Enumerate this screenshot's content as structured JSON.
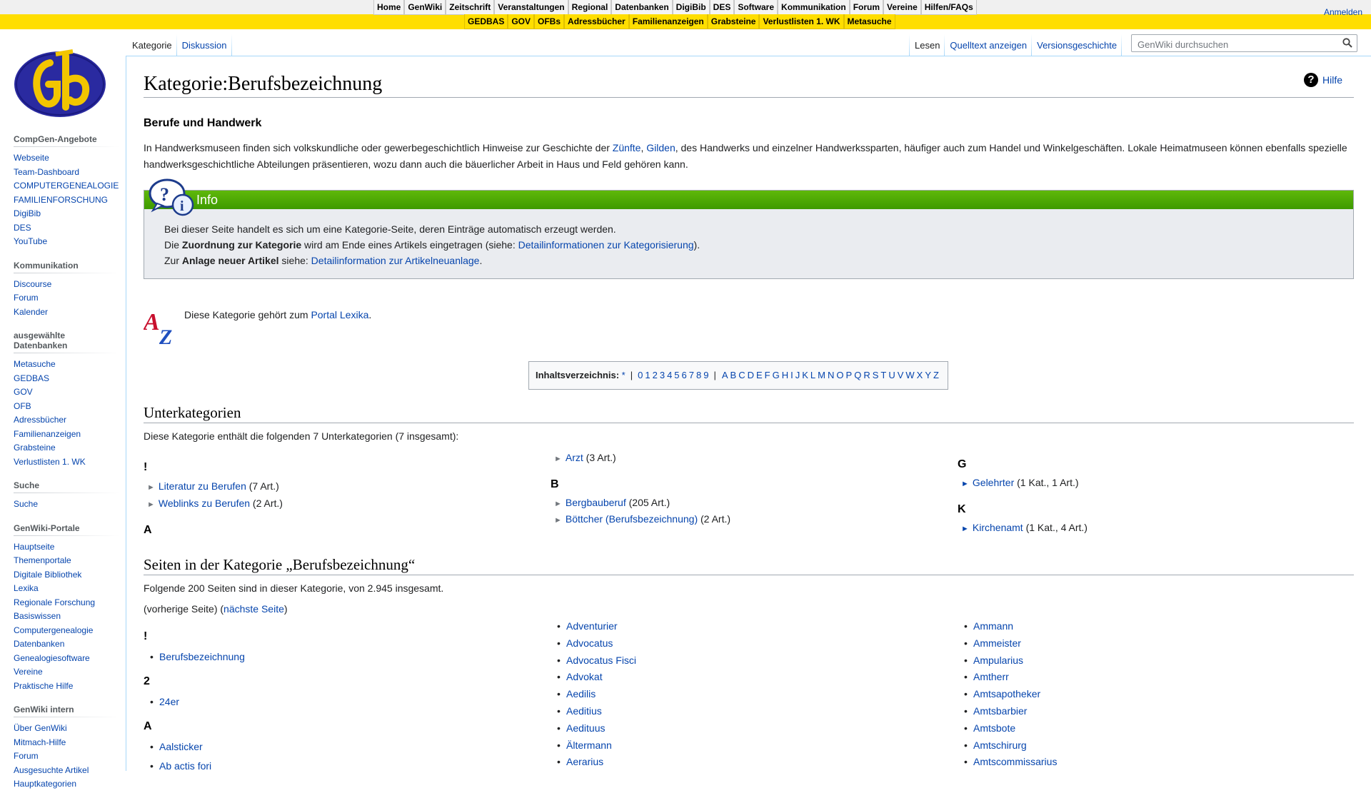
{
  "topnav": {
    "row1": [
      "Home",
      "GenWiki",
      "Zeitschrift",
      "Veranstaltungen",
      "Regional",
      "Datenbanken",
      "DigiBib",
      "DES",
      "Software",
      "Kommunikation",
      "Forum",
      "Vereine",
      "Hilfen/FAQs"
    ],
    "row2": [
      "GEDBAS",
      "GOV",
      "OFBs",
      "Adressbücher",
      "Familienanzeigen",
      "Grabsteine",
      "Verlustlisten 1. WK",
      "Metasuche"
    ],
    "login": "Anmelden"
  },
  "tabs": {
    "left": [
      "Kategorie",
      "Diskussion"
    ],
    "right": [
      "Lesen",
      "Quelltext anzeigen",
      "Versionsgeschichte"
    ]
  },
  "search": {
    "placeholder": "GenWiki durchsuchen"
  },
  "sidebar": [
    {
      "heading": "CompGen-Angebote",
      "items": [
        "Webseite",
        "Team-Dashboard",
        "COMPUTERGENEALOGIE",
        "FAMILIENFORSCHUNG",
        "DigiBib",
        "DES",
        "YouTube"
      ]
    },
    {
      "heading": "Kommunikation",
      "items": [
        "Discourse",
        "Forum",
        "Kalender"
      ]
    },
    {
      "heading": "ausgewählte Datenbanken",
      "items": [
        "Metasuche",
        "GEDBAS",
        "GOV",
        "OFB",
        "Adressbücher",
        "Familienanzeigen",
        "Grabsteine",
        "Verlustlisten 1. WK"
      ]
    },
    {
      "heading": "Suche",
      "items": [
        "Suche"
      ]
    },
    {
      "heading": "GenWiki-Portale",
      "items": [
        "Hauptseite",
        "Themenportale",
        "Digitale Bibliothek",
        "Lexika",
        "Regionale Forschung",
        "Basiswissen",
        "Computergenealogie",
        "Datenbanken",
        "Genealogiesoftware",
        "Vereine",
        "Praktische Hilfe"
      ]
    },
    {
      "heading": "GenWiki intern",
      "items": [
        "Über GenWiki",
        "Mitmach-Hilfe",
        "Forum",
        "Ausgesuchte Artikel",
        "Hauptkategorien"
      ]
    }
  ],
  "page": {
    "title": "Kategorie:Berufsbezeichnung",
    "help": "Hilfe",
    "subheading": "Berufe und Handwerk",
    "intro": {
      "t1": "In Handwerksmuseen finden sich volkskundliche oder gewerbegeschichtlich Hinweise zur Geschichte der ",
      "l1": "Zünfte",
      "t2": ", ",
      "l2": "Gilden",
      "t3": ", des Handwerks und einzelner Handwerkssparten, häufiger auch zum Handel und Winkelgeschäften. Lokale Heimatmuseen können ebenfalls spezielle handwerksgeschichtliche Abteilungen präsentieren, wozu dann auch die bäuerlicher Arbeit in Haus und Feld gehören kann."
    },
    "info": {
      "title": "Info",
      "line1": "Bei dieser Seite handelt es sich um eine Kategorie-Seite, deren Einträge automatisch erzeugt werden.",
      "line2a": "Die ",
      "line2b": "Zuordnung zur Kategorie",
      "line2c": " wird am Ende eines Artikels eingetragen (siehe: ",
      "line2link": "Detailinformationen zur Kategorisierung",
      "line2d": ").",
      "line3a": "Zur ",
      "line3b": "Anlage neuer Artikel",
      "line3c": " siehe: ",
      "line3link": "Detailinformation zur Artikelneuanlage",
      "line3d": "."
    },
    "portal": {
      "text": "Diese Kategorie gehört zum ",
      "link": "Portal Lexika",
      "end": "."
    },
    "toc": {
      "label": "Inhaltsverzeichnis:",
      "star": "*",
      "sep": "|",
      "digits": [
        "0",
        "1",
        "2",
        "3",
        "4",
        "5",
        "6",
        "7",
        "8",
        "9"
      ],
      "letters": [
        "A",
        "B",
        "C",
        "D",
        "E",
        "F",
        "G",
        "H",
        "I",
        "J",
        "K",
        "L",
        "M",
        "N",
        "O",
        "P",
        "Q",
        "R",
        "S",
        "T",
        "U",
        "V",
        "W",
        "X",
        "Y",
        "Z"
      ]
    },
    "subcats": {
      "heading": "Unterkategorien",
      "desc": "Diese Kategorie enthält die folgenden 7 Unterkategorien (7 insgesamt):",
      "col1": {
        "h1": "!",
        "i1": "Literatur zu Berufen",
        "c1": "(7 Art.)",
        "i2": "Weblinks zu Berufen",
        "c2": "(2 Art.)",
        "h2": "A"
      },
      "col2": {
        "i0": "Arzt",
        "c0": "(3 Art.)",
        "h1": "B",
        "i1": "Bergbauberuf",
        "c1": "(205 Art.)",
        "i2": "Böttcher (Berufsbezeichnung)",
        "c2": "(2 Art.)"
      },
      "col3": {
        "h1": "G",
        "i1": "Gelehrter",
        "c1": "(1 Kat., 1 Art.)",
        "h2": "K",
        "i2": "Kirchenamt",
        "c2": "(1 Kat., 4 Art.)"
      }
    },
    "pages": {
      "heading": "Seiten in der Kategorie „Berufsbezeichnung“",
      "desc": "Folgende 200 Seiten sind in dieser Kategorie, von 2.945 insgesamt.",
      "nav_prev": "(vorherige Seite) (",
      "nav_next": "nächste Seite",
      "nav_end": ")",
      "col1": [
        {
          "h": "!"
        },
        {
          "i": "Berufsbezeichnung"
        },
        {
          "h": "2"
        },
        {
          "i": "24er"
        },
        {
          "h": "A"
        },
        {
          "i": "Aalsticker"
        },
        {
          "i": "Ab actis fori"
        }
      ],
      "col2": [
        "Adventurier",
        "Advocatus",
        "Advocatus Fisci",
        "Advokat",
        "Aedilis",
        "Aeditius",
        "Aedituus",
        "Ältermann",
        "Aerarius"
      ],
      "col3": [
        "Ammann",
        "Ammeister",
        "Ampularius",
        "Amtherr",
        "Amtsapotheker",
        "Amtsbarbier",
        "Amtsbote",
        "Amtschirurg",
        "Amtscommissarius"
      ]
    }
  }
}
